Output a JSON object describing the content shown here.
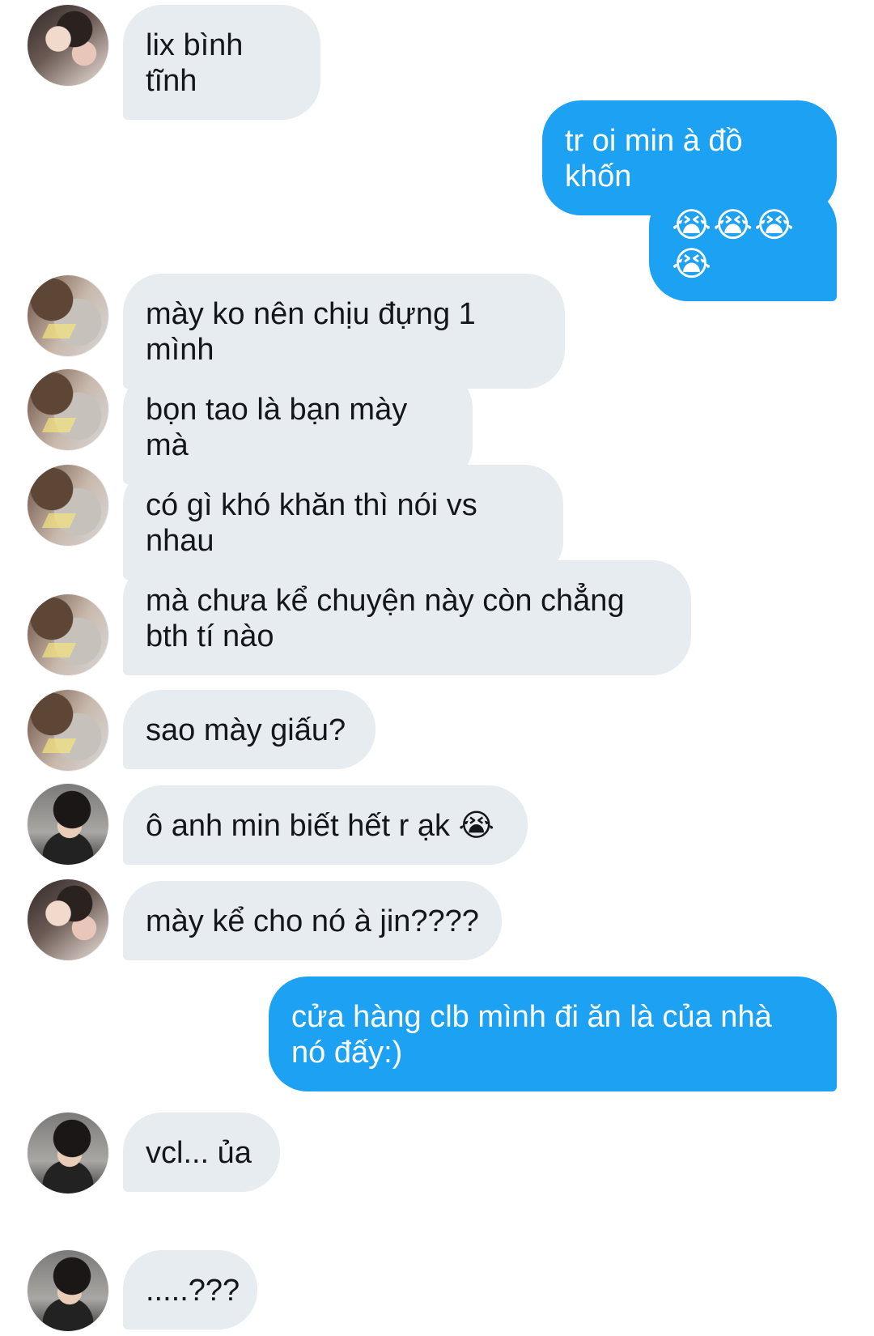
{
  "messages": [
    {
      "text": "lix bình tĩnh"
    },
    {
      "text": "tr oi min à đồ khốn"
    },
    {
      "text": "😭😭😭😭"
    },
    {
      "text": "mày ko nên chịu đựng 1 mình"
    },
    {
      "text": "bọn tao là bạn mày mà"
    },
    {
      "text": "có gì khó khăn thì nói vs nhau"
    },
    {
      "text": "mà chưa kể chuyện này còn chẳng bth tí nào"
    },
    {
      "text": "sao mày giấu?"
    },
    {
      "text": "ô anh min biết hết r ạk 😭"
    },
    {
      "text": "mày kể cho nó à jin????"
    },
    {
      "text": "cửa hàng clb mình đi ăn là của nhà nó đấy:)"
    },
    {
      "text": "vcl... ủa"
    },
    {
      "text": ".....???"
    }
  ]
}
